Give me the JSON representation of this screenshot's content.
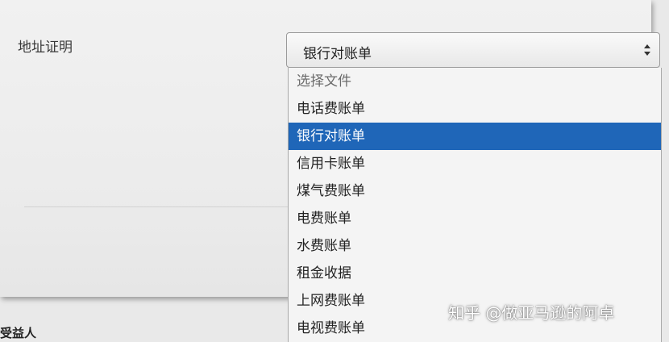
{
  "form": {
    "address_proof_label": "地址证明",
    "beneficiary_label": "受益人"
  },
  "select": {
    "value": "银行对账单",
    "options": [
      {
        "label": "选择文件",
        "placeholder": true
      },
      {
        "label": "电话费账单"
      },
      {
        "label": "银行对账单",
        "selected": true
      },
      {
        "label": "信用卡账单"
      },
      {
        "label": "煤气费账单"
      },
      {
        "label": "电费账单"
      },
      {
        "label": "水费账单"
      },
      {
        "label": "租金收据"
      },
      {
        "label": "上网费账单"
      },
      {
        "label": "电视费账单"
      }
    ]
  },
  "watermark": "知乎 @做亚马逊的阿卓",
  "colors": {
    "selected_bg": "#1f66b8",
    "selected_text": "#ffffff",
    "page_bg": "#e9e9e9"
  }
}
